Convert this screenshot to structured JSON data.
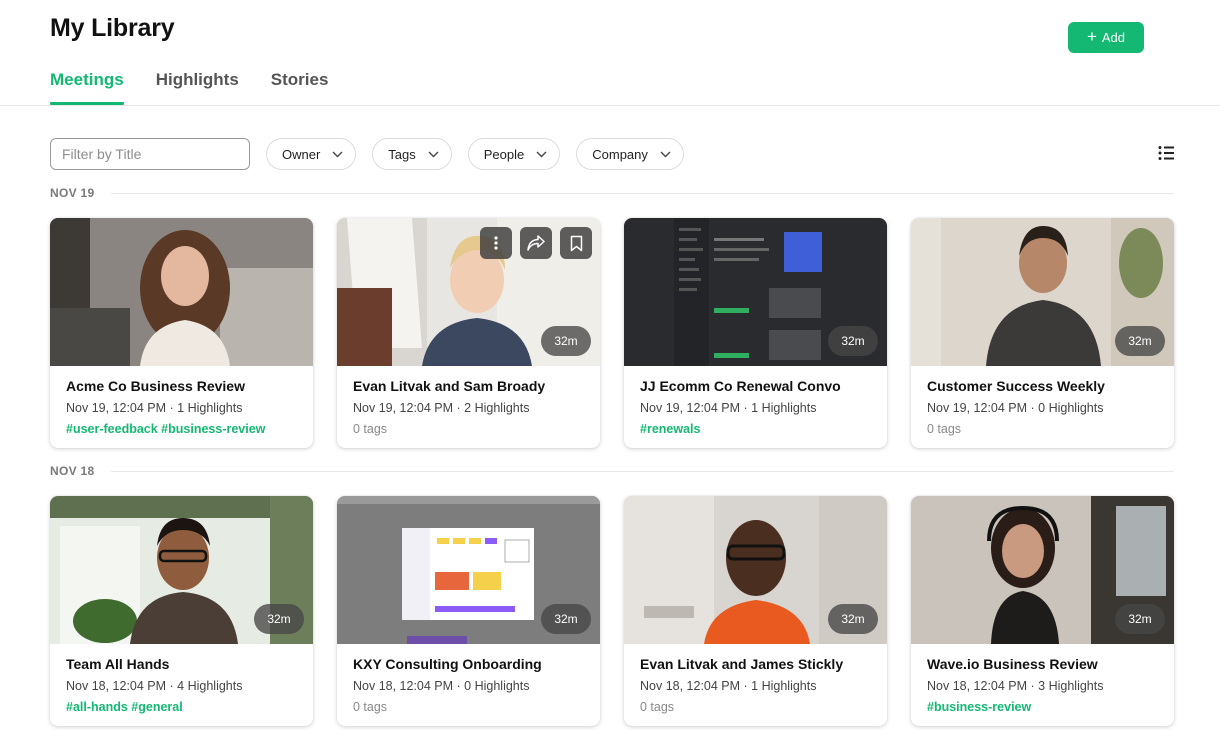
{
  "header": {
    "title": "My Library",
    "add_label": "Add",
    "tabs": [
      {
        "label": "Meetings",
        "active": true
      },
      {
        "label": "Highlights",
        "active": false
      },
      {
        "label": "Stories",
        "active": false
      }
    ]
  },
  "filters": {
    "title_placeholder": "Filter by Title",
    "dropdowns": [
      "Owner",
      "Tags",
      "People",
      "Company"
    ],
    "view_icon": "list-view-icon"
  },
  "colors": {
    "accent": "#14b873",
    "duration_badge": "#464646"
  },
  "groups": [
    {
      "label": "NOV 19",
      "meetings": [
        {
          "title": "Acme Co Business Review",
          "meta": "Nov 19, 12:04 PM · 1 Highlights",
          "tags": "#user-feedback #business-review",
          "has_tags": true,
          "duration": "",
          "hovered": false
        },
        {
          "title": "Evan Litvak and Sam Broady",
          "meta": "Nov 19, 12:04 PM · 2 Highlights",
          "tags": "0 tags",
          "has_tags": false,
          "duration": "32m",
          "hovered": true
        },
        {
          "title": "JJ Ecomm Co Renewal Convo",
          "meta": "Nov 19, 12:04 PM · 1 Highlights",
          "tags": "#renewals",
          "has_tags": true,
          "duration": "32m",
          "hovered": false
        },
        {
          "title": "Customer Success Weekly",
          "meta": "Nov 19, 12:04 PM · 0 Highlights",
          "tags": "0 tags",
          "has_tags": false,
          "duration": "32m",
          "hovered": false
        }
      ]
    },
    {
      "label": "NOV 18",
      "meetings": [
        {
          "title": "Team All Hands",
          "meta": "Nov 18, 12:04 PM · 4 Highlights",
          "tags": "#all-hands #general",
          "has_tags": true,
          "duration": "32m",
          "hovered": false
        },
        {
          "title": "KXY Consulting Onboarding",
          "meta": "Nov 18, 12:04 PM · 0 Highlights",
          "tags": "0 tags",
          "has_tags": false,
          "duration": "32m",
          "hovered": false
        },
        {
          "title": "Evan Litvak and James Stickly",
          "meta": "Nov 18, 12:04 PM · 1 Highlights",
          "tags": "0 tags",
          "has_tags": false,
          "duration": "32m",
          "hovered": false
        },
        {
          "title": "Wave.io Business Review",
          "meta": "Nov 18, 12:04 PM · 3 Highlights",
          "tags": "#business-review",
          "has_tags": true,
          "duration": "32m",
          "hovered": false
        }
      ]
    }
  ]
}
